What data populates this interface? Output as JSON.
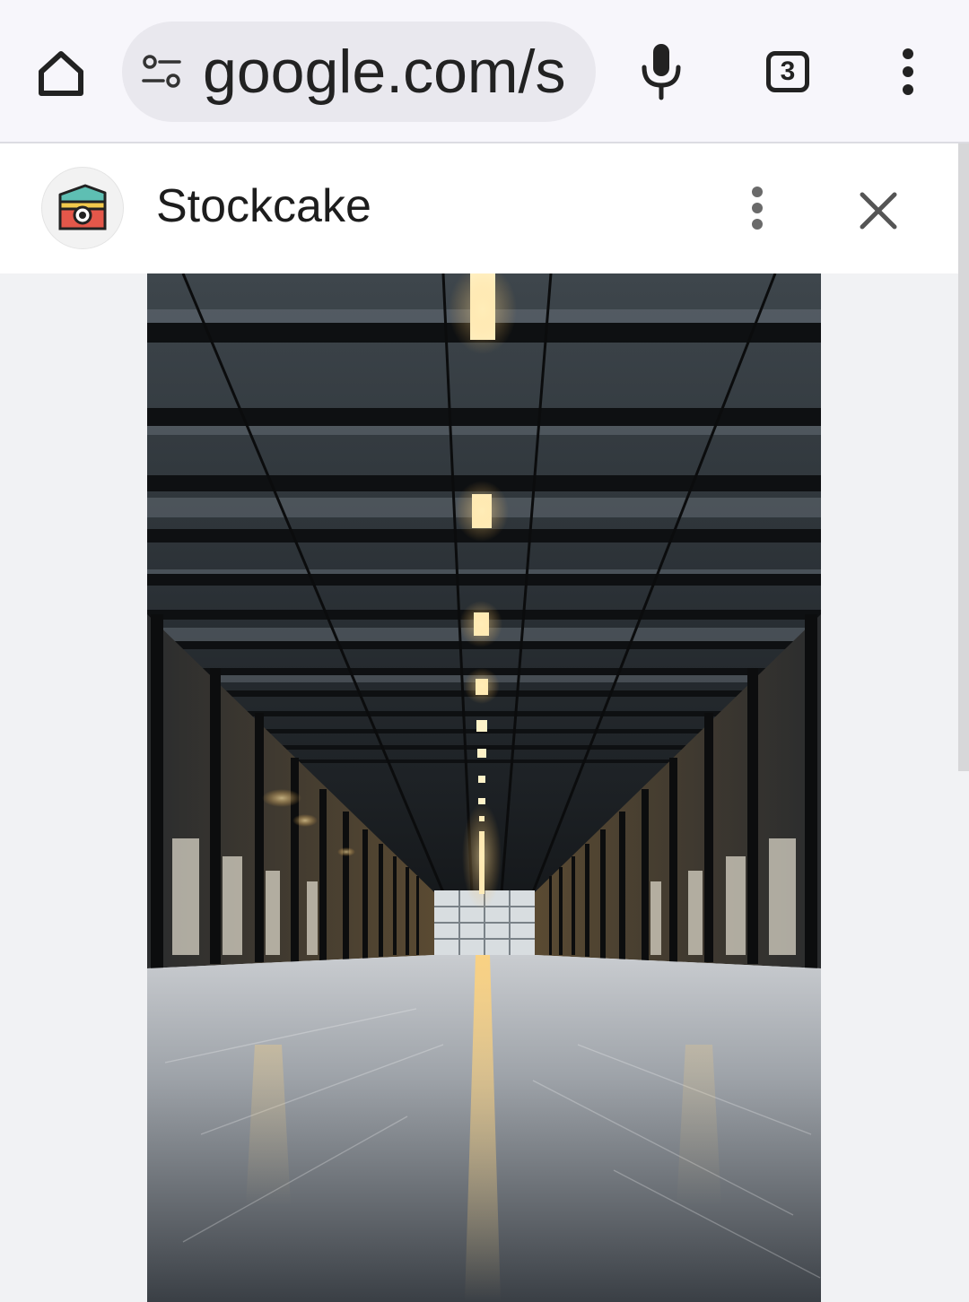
{
  "browser": {
    "url_display": "google.com/s",
    "tab_count": "3",
    "icons": {
      "home": "home-icon",
      "site_settings": "tune-icon",
      "voice": "mic-icon",
      "tabs": "tab-switcher-icon",
      "menu": "more-vert-icon"
    }
  },
  "site_panel": {
    "site_name": "Stockcake",
    "icons": {
      "logo": "stockcake-logo",
      "menu": "more-vert-icon",
      "close": "close-icon"
    }
  },
  "image": {
    "subject": "empty-warehouse-interior-photo"
  },
  "colors": {
    "toolbar_bg": "#f7f6fb",
    "urlbar_bg": "#e9e8ee",
    "content_bg": "#f1f2f4"
  }
}
